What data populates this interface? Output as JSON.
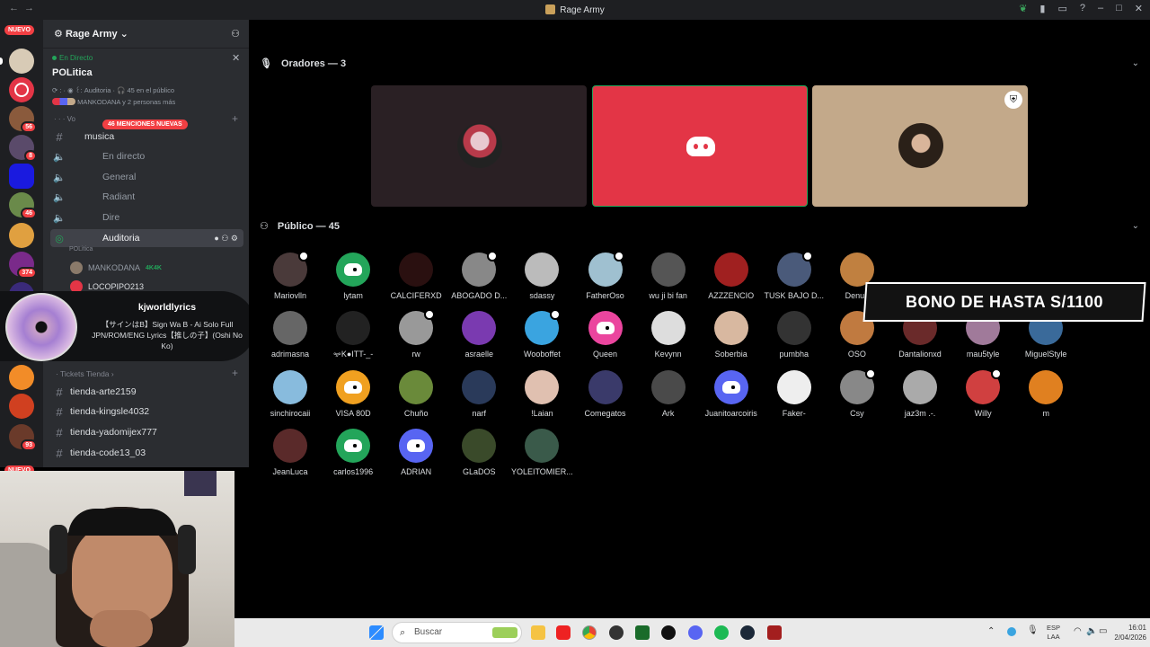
{
  "window": {
    "title": "Rage Army"
  },
  "servers": {
    "new_top": "NUEVO",
    "new_bottom": "NUEVO",
    "badges": [
      "56",
      "8",
      "46",
      "374",
      "93"
    ]
  },
  "guild": {
    "name": "Rage Army"
  },
  "live": {
    "status": "En Directo",
    "stage_name": "POLitica",
    "meta": "⟳ : · ◉ ꒰: Auditoria · 🎧 45 en el público",
    "people": "MANKODANA y 2 personas más"
  },
  "mentions_badge": "46 MENCIONES NUEVAS",
  "channels": [
    {
      "icon": "#",
      "label": "musica"
    },
    {
      "icon": "◁",
      "label": "En directo"
    },
    {
      "icon": "◁",
      "label": "General"
    },
    {
      "icon": "◁",
      "label": "Radiant"
    },
    {
      "icon": "◁",
      "label": "Dire"
    },
    {
      "icon": "◎",
      "label": "Auditoria"
    }
  ],
  "stage_sub": "POLitica",
  "voice_users": [
    {
      "name": "MANKODANA",
      "tag": "4K4K"
    },
    {
      "name": "LOCOPIPO213"
    }
  ],
  "now_playing": {
    "user": "kjworldlyrics",
    "song": "【サインはB】Sign Wa B - Ai Solo Full JPN/ROM/ENG Lyrics【推しの子】(Oshi No Ko)"
  },
  "ticket_category": "Tickets Tienda",
  "ticket_channels": [
    "tienda-arte2159",
    "tienda-kingsle4032",
    "tienda-yadomijex777",
    "tienda-code13_03"
  ],
  "speakers": {
    "header": "Oradores — 3"
  },
  "audience": {
    "header": "Público — 45",
    "members": [
      "Mariovlln",
      "lytam",
      "CALCIFERXD",
      "ABOGADO D...",
      "sdassy",
      "FatherOso",
      "wu ji bi fan",
      "AZZZENCIO",
      "TUSK BAJO D...",
      "Denue",
      "",
      "",
      "",
      "adrimasna",
      "ꗁK●ITT-_-",
      "rw",
      "asraelle",
      "Wooboffet",
      "Queen",
      "Kevynn",
      "Soberbia",
      "pumbha",
      "OSO",
      "Dantalionxd",
      "mau5tyle",
      "MiguelStyle",
      "sinchirocaii",
      "VISA 80D",
      "Chuño",
      "narf",
      "!Laian",
      "Comegatos",
      "Ark",
      "Juanitoarcoiris",
      "Faker-",
      "Csy",
      "jaz3m .-.",
      "Willy",
      "m",
      "JeanLuca",
      "carlos1996",
      "ADRIAN",
      "GLaDOS",
      "YOLEITOMIER..."
    ]
  },
  "overlay": {
    "text": "BONO DE HASTA S/1100"
  },
  "taskbar": {
    "search_placeholder": "Buscar",
    "lang": "ESP",
    "lang2": "LAA",
    "time": "16:01",
    "date": "2/04/2026"
  },
  "colors": {
    "accent": "#5865f2",
    "live_green": "#23a55a",
    "danger": "#f23f43",
    "speaker_red": "#e33546",
    "speaker_tan": "#c3a98a"
  }
}
